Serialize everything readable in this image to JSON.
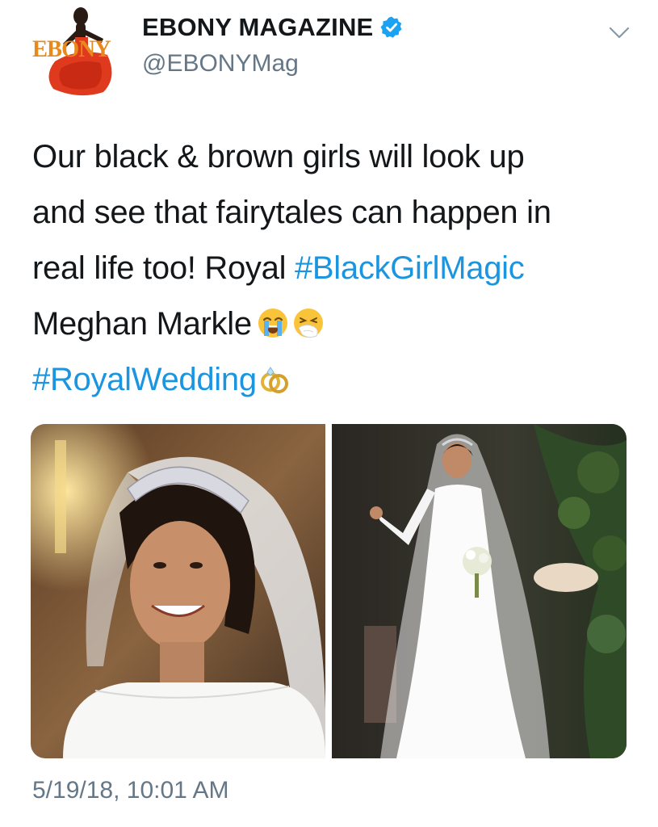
{
  "author": {
    "display_name": "EBONY MAGAZINE",
    "handle": "@EBONYMag",
    "verified": true,
    "avatar_logo_text": "EBONY"
  },
  "tweet": {
    "lines": [
      {
        "parts": [
          {
            "text": "Our black & brown girls will look up",
            "type": "text"
          }
        ]
      },
      {
        "parts": [
          {
            "text": "and see that fairytales can happen in",
            "type": "text"
          }
        ]
      },
      {
        "parts": [
          {
            "text": "real life too! Royal ",
            "type": "text"
          },
          {
            "text": "#BlackGirlMagic",
            "type": "hashtag"
          }
        ]
      },
      {
        "parts": [
          {
            "text": "Meghan Markle",
            "type": "text"
          }
        ]
      },
      {
        "parts": [
          {
            "text": "#RoyalWedding",
            "type": "hashtag"
          }
        ]
      }
    ],
    "emojis": [
      "loudly-crying-face",
      "sneezing-face",
      "rings"
    ],
    "timestamp": "5/19/18, 10:01 AM"
  },
  "media": {
    "photos": [
      {
        "name": "bride-portrait-photo"
      },
      {
        "name": "bride-full-gown-photo"
      }
    ]
  },
  "colors": {
    "text": "#14171a",
    "secondary": "#657786",
    "link": "#1b95e0",
    "verified": "#1da1f2"
  },
  "icons": {
    "verified": "verified-badge-icon",
    "caret": "chevron-down-icon"
  }
}
